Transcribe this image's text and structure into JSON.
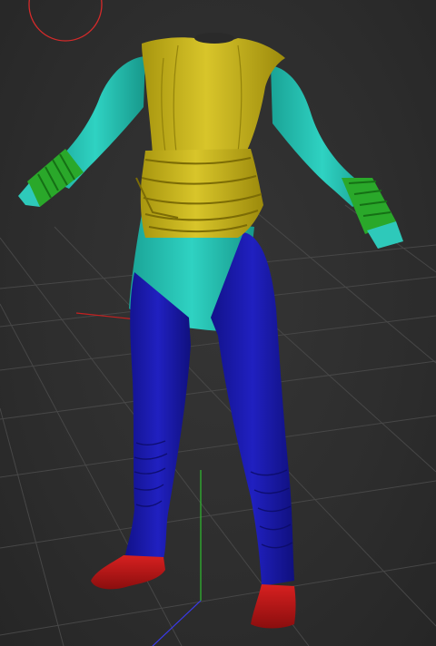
{
  "viewport": {
    "background": "#2e2e2e",
    "grid_color": "#4a4a4a",
    "x_axis_color": "#c62020",
    "y_axis_color": "#2fbf2f",
    "z_axis_color": "#3a3af0",
    "gizmo_color": "#d42a2a",
    "material_colors": {
      "vest": "#c9b41c",
      "belt": "#b9a412",
      "sleeves_and_tunic": "#22c1b2",
      "bracers": "#2aa82a",
      "pants": "#1a1aa8",
      "boots": "#c01818"
    }
  }
}
